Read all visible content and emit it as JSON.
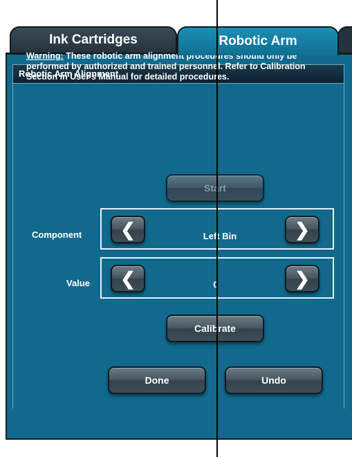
{
  "tabs": [
    {
      "label": "Ink Cartridges",
      "active": false
    },
    {
      "label": "Robotic Arm",
      "active": true
    }
  ],
  "panel": {
    "title": "Robotic Arm Alignment",
    "warning_label": "Warning:",
    "warning_text": "These robotic arm alignment procedures should only be performed by authorized and trained personnel. Refer to Calibration Section in User's Manual for detailed procedures."
  },
  "controls": {
    "start_label": "Start",
    "component": {
      "label": "Component",
      "value": "Left Bin"
    },
    "value": {
      "label": "Value",
      "value": "0"
    },
    "calibrate_label": "Calibrate",
    "done_label": "Done",
    "undo_label": "Undo"
  },
  "icons": {
    "left": "chevron-left-icon",
    "right": "chevron-right-icon"
  },
  "colors": {
    "panel": "#116a8d",
    "active_tab": "#1c8fb4",
    "inactive_tab": "#2f3e48",
    "button": "#46555e"
  }
}
